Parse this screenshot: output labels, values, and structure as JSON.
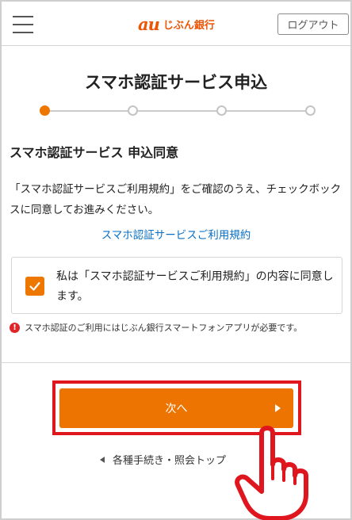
{
  "header": {
    "logo_brand": "au",
    "logo_text": "じぶん銀行",
    "logout_label": "ログアウト"
  },
  "page": {
    "title": "スマホ認証サービス申込",
    "step_count": 4,
    "active_step": 1,
    "section_heading": "スマホ認証サービス 申込同意",
    "description": "「スマホ認証サービスご利用規約」をご確認のうえ、チェックボックスに同意してお進みください。",
    "terms_link": "スマホ認証サービスご利用規約",
    "agree_text": "私は「スマホ認証サービスご利用規約」の内容に同意します。",
    "agree_checked": true,
    "notice_icon": "!",
    "notice": "スマホ認証のご利用にはじぶん銀行スマートフォンアプリが必要です。",
    "next_label": "次へ",
    "back_label": "各種手続き・照会トップ"
  },
  "colors": {
    "brand": "#eb5505",
    "accent": "#ee7700",
    "link": "#0a6fc2",
    "highlight": "#e0161e",
    "notice": "#e0242a"
  }
}
